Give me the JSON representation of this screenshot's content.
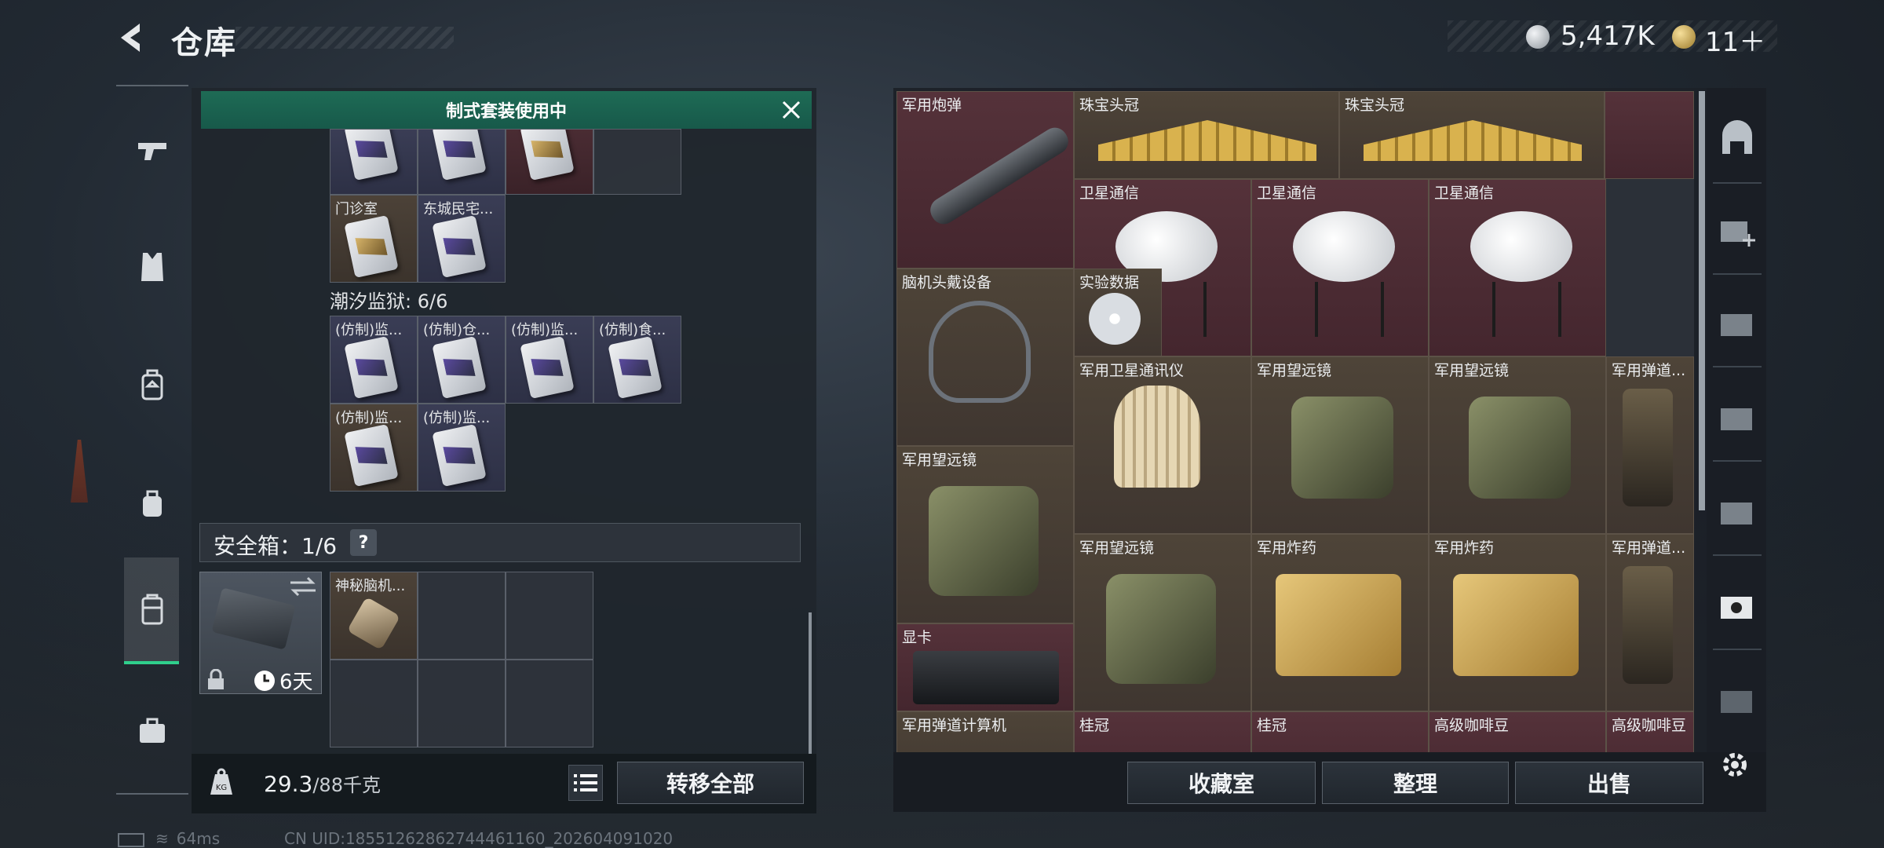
{
  "header": {
    "title": "仓库",
    "currency_silver": "5,417K",
    "currency_gold": "11＋"
  },
  "banner": {
    "text": "制式套装使用中"
  },
  "left_grid": {
    "row2": [
      "门诊室",
      "东城民宅..."
    ],
    "section_title": "潮汐监狱: 6/6",
    "prison_row1": [
      "(仿制)监...",
      "(仿制)仓...",
      "(仿制)监...",
      "(仿制)食..."
    ],
    "prison_row2": [
      "(仿制)监...",
      "(仿制)监..."
    ]
  },
  "safe": {
    "label": "安全箱：1/6",
    "help": "?",
    "timer": "6天",
    "item": "神秘脑机..."
  },
  "bottom_left": {
    "weight": "29.3",
    "weight_max": "/88千克",
    "transfer_all": "转移全部"
  },
  "right_grid": {
    "items": [
      "军用炮弹",
      "珠宝头冠",
      "珠宝头冠",
      "卫星通信",
      "卫星通信",
      "卫星通信",
      "脑机头戴设备",
      "实验数据",
      "军用卫星通讯仪",
      "军用望远镜",
      "军用望远镜",
      "军用弹道...",
      "军用望远镜",
      "军用望远镜",
      "军用炸药",
      "军用炸药",
      "军用弹道...",
      "显卡",
      "军用弹道计算机",
      "桂冠",
      "桂冠",
      "高级咖啡豆",
      "高级咖啡豆"
    ]
  },
  "bottom_right": {
    "collection": "收藏室",
    "organize": "整理",
    "sell": "出售"
  },
  "footer": {
    "ping": "64ms",
    "uid": "CN UID:18551262862744461160_202604091020"
  },
  "icons": [
    "back-arrow-icon",
    "pistol-icon",
    "vest-icon",
    "backpack-icon",
    "bag-icon",
    "safe-case-icon",
    "briefcase-icon",
    "vault-icon",
    "add-storage-icon",
    "storage-iv-icon",
    "settings-gear-icon",
    "list-icon",
    "weight-icon",
    "close-icon",
    "clock-icon",
    "lock-icon",
    "swap-icon"
  ],
  "colors": {
    "accent_green": "#2fcf8c",
    "banner_green": "#1e6b55",
    "rare_red": "#55323a",
    "epic_purple": "#3a3d55"
  }
}
